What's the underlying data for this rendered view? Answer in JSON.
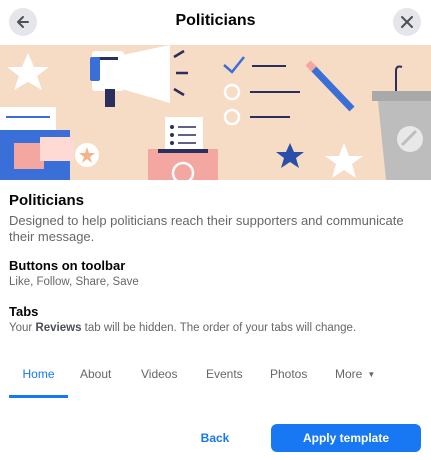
{
  "header": {
    "title": "Politicians",
    "back_icon": "arrow-left-icon",
    "close_icon": "close-icon"
  },
  "banner": {
    "icon": "politics-illustration",
    "colors": {
      "background": "#f6dcc4",
      "blue": "#3b6fd8",
      "pink": "#f4a6a0",
      "navy": "#2a2f5e"
    }
  },
  "template": {
    "title": "Politicians",
    "description": "Designed to help politicians reach their supporters and communicate their message."
  },
  "sections": {
    "toolbar_heading": "Buttons on toolbar",
    "toolbar_buttons": "Like, Follow, Share, Save",
    "tabs_heading": "Tabs",
    "tabs_note_prefix": "Your ",
    "tabs_note_bold": "Reviews",
    "tabs_note_suffix": " tab will be hidden. The order of your tabs will change."
  },
  "tabs": {
    "home": "Home",
    "about": "About",
    "videos": "Videos",
    "events": "Events",
    "photos": "Photos",
    "more": "More",
    "active": "Home"
  },
  "footer": {
    "back_label": "Back",
    "apply_label": "Apply template"
  },
  "colors": {
    "accent": "#1877f2",
    "secondary_text": "#65676b"
  }
}
